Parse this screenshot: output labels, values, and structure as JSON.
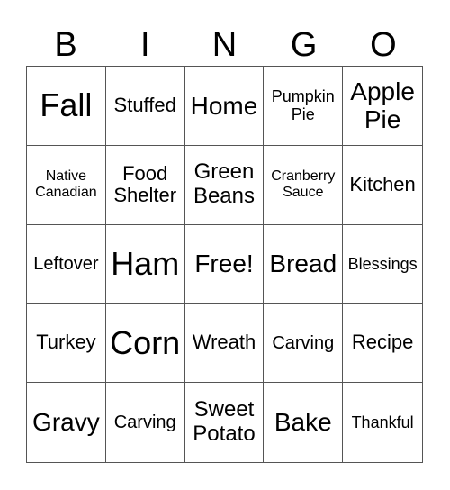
{
  "header": [
    "B",
    "I",
    "N",
    "G",
    "O"
  ],
  "cells": [
    {
      "text": "Fall",
      "size": "s36"
    },
    {
      "text": "Stuffed",
      "size": "s22"
    },
    {
      "text": "Home",
      "size": "s28"
    },
    {
      "text": "Pumpkin Pie",
      "size": "s18"
    },
    {
      "text": "Apple Pie",
      "size": "s28"
    },
    {
      "text": "Native Canadian",
      "size": "s16"
    },
    {
      "text": "Food Shelter",
      "size": "s22"
    },
    {
      "text": "Green Beans",
      "size": "s24"
    },
    {
      "text": "Cranberry Sauce",
      "size": "s16"
    },
    {
      "text": "Kitchen",
      "size": "s22"
    },
    {
      "text": "Leftover",
      "size": "s20"
    },
    {
      "text": "Ham",
      "size": "s36"
    },
    {
      "text": "Free!",
      "size": "s28"
    },
    {
      "text": "Bread",
      "size": "s28"
    },
    {
      "text": "Blessings",
      "size": "s18"
    },
    {
      "text": "Turkey",
      "size": "s22"
    },
    {
      "text": "Corn",
      "size": "s36"
    },
    {
      "text": "Wreath",
      "size": "s22"
    },
    {
      "text": "Carving",
      "size": "s20"
    },
    {
      "text": "Recipe",
      "size": "s22"
    },
    {
      "text": "Gravy",
      "size": "s28"
    },
    {
      "text": "Carving",
      "size": "s20"
    },
    {
      "text": "Sweet Potato",
      "size": "s24"
    },
    {
      "text": "Bake",
      "size": "s28"
    },
    {
      "text": "Thankful",
      "size": "s18"
    }
  ]
}
